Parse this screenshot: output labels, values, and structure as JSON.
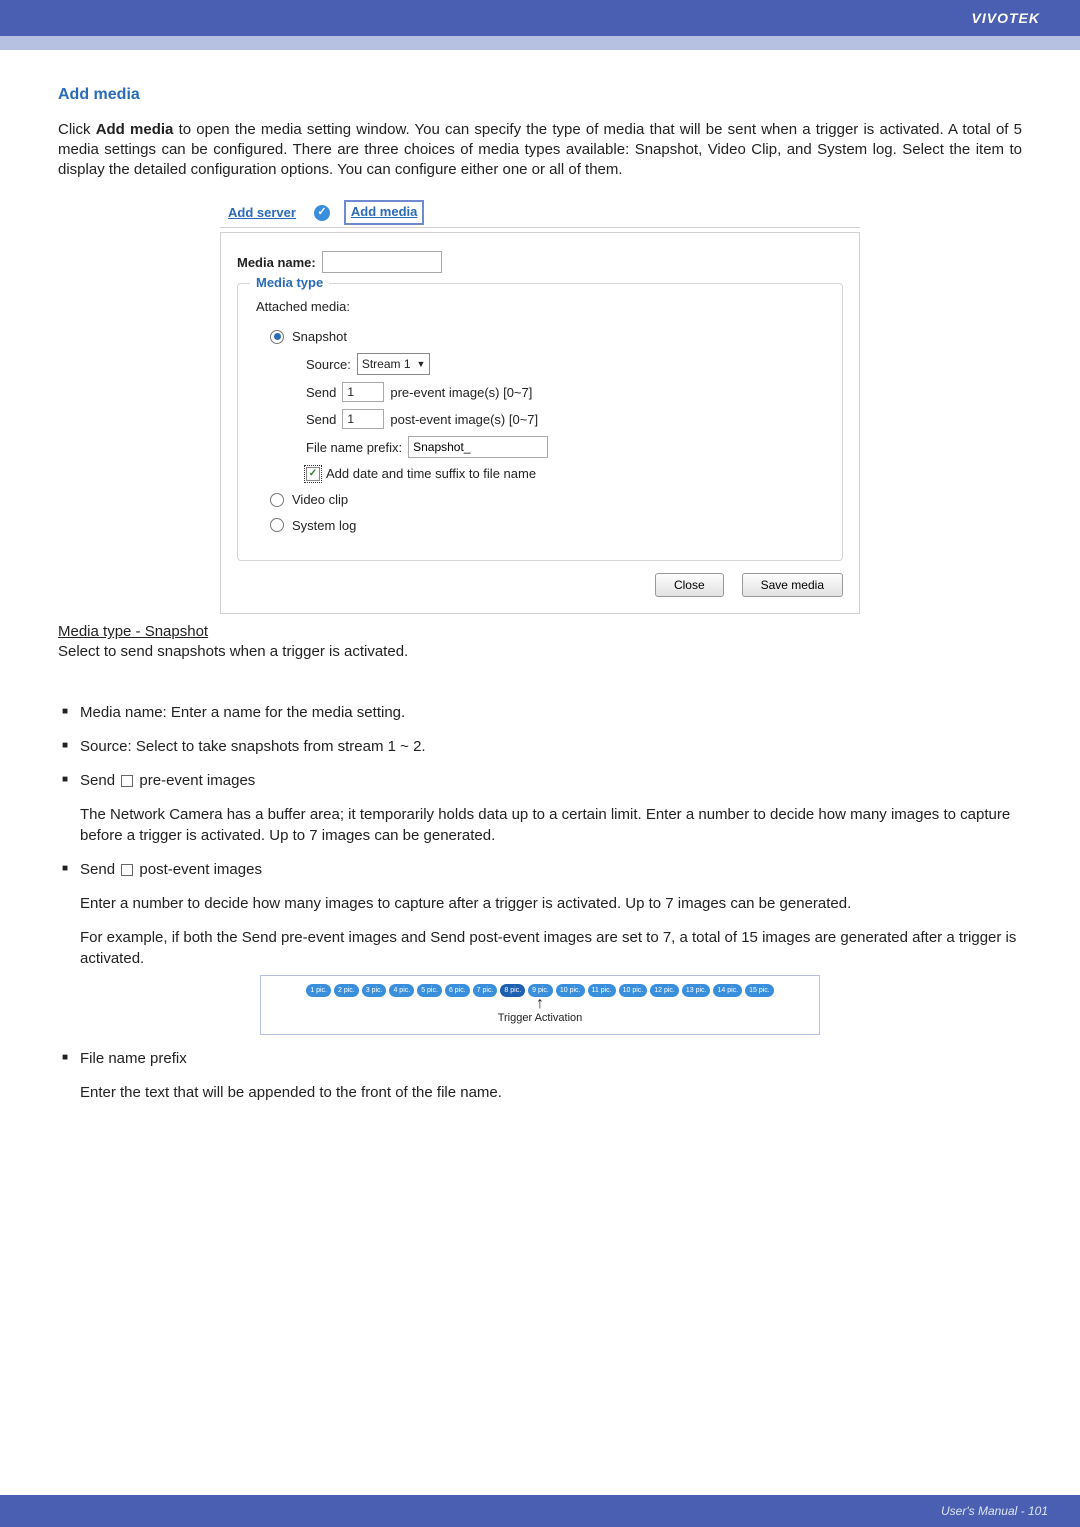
{
  "header": {
    "brand": "VIVOTEK"
  },
  "section": {
    "title": "Add media"
  },
  "intro": {
    "p1a": "Click ",
    "p1b": "Add media",
    "p1c": " to open the media setting window. You can specify the type of media that will be sent when a trigger is activated. A total of 5 media settings can be configured. There are three choices of media types available: Snapshot, Video Clip, and System log. Select the item to display the detailed configuration options. You can configure either one or all of them."
  },
  "ui": {
    "links": {
      "server": "Add server",
      "media": "Add media"
    },
    "media_name_label": "Media name:",
    "media_name_value": "",
    "fieldset_title": "Media type",
    "attached_label": "Attached media:",
    "radio": {
      "snapshot": "Snapshot",
      "video": "Video clip",
      "syslog": "System log"
    },
    "snapshot": {
      "source_label": "Source:",
      "source_value": "Stream 1",
      "send_label": "Send",
      "pre_value": "1",
      "pre_suffix": "pre-event image(s) [0~7]",
      "post_value": "1",
      "post_suffix": "post-event image(s) [0~7]",
      "prefix_label": "File name prefix:",
      "prefix_value": "Snapshot_",
      "suffix_check_label": "Add date and time suffix to file name"
    },
    "buttons": {
      "close": "Close",
      "save": "Save media"
    }
  },
  "below": {
    "heading": "Media type - Snapshot",
    "sub": "Select to send snapshots when a trigger is activated.",
    "b1": "Media name: Enter a name for the media setting.",
    "b2": "Source: Select to take snapshots from stream 1 ~ 2.",
    "b3_t": "Send",
    "b3_a": " pre-event images",
    "b3_b": "The Network Camera has a buffer area; it temporarily holds data up to a certain limit. Enter a number to decide how many images to capture before a trigger is activated. Up to 7 images can be generated.",
    "b4_t": "Send",
    "b4_a": " post-event images",
    "b4_b": "Enter a number to decide how many images to capture after a trigger is activated. Up to 7 images can be generated.",
    "b4_c": "For example, if both the Send pre-event images and Send post-event images are set to 7, a total of 15 images are generated after a trigger is activated.",
    "diagram": {
      "pics": [
        "1 pic.",
        "2 pic.",
        "3 pic.",
        "4 pic.",
        "5 pic.",
        "6 pic.",
        "7 pic.",
        "8 pic.",
        "9 pic.",
        "10 pic.",
        "11 pic.",
        "10 pic.",
        "12 pic.",
        "13 pic.",
        "14 pic.",
        "15 pic."
      ],
      "label": "Trigger Activation"
    },
    "b5_t": "File name prefix",
    "b5_b": "Enter the text that will be appended to the front of the file name."
  },
  "footer": {
    "page": "User's Manual - 101"
  }
}
